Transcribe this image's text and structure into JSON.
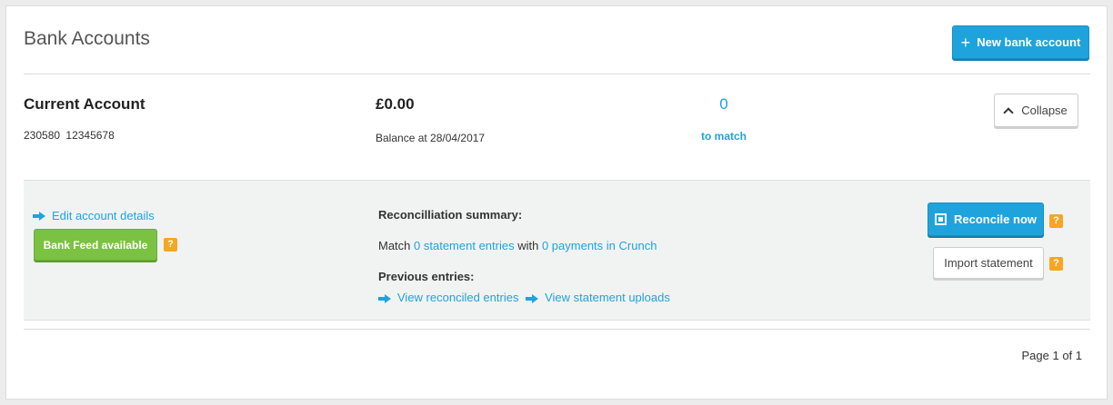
{
  "header": {
    "title": "Bank Accounts",
    "new_button_icon": "plus-icon",
    "new_button_label": "New bank account"
  },
  "account": {
    "name": "Current Account",
    "sort_code": "230580",
    "account_number": "12345678",
    "balance": "£0.00",
    "balance_label": "Balance at 28/04/2017",
    "to_match_count": "0",
    "to_match_label": "to match",
    "collapse_label": "Collapse"
  },
  "details": {
    "edit_link": "Edit account details",
    "bank_feed_label": "Bank Feed available",
    "help_glyph": "?",
    "reconciliation_title": "Reconcilliation summary:",
    "match_prefix": "Match",
    "statement_entries_link": "0 statement entries",
    "with_text": "with",
    "payments_link": "0 payments in Crunch",
    "previous_title": "Previous entries:",
    "view_reconciled_link": "View reconciled entries",
    "view_uploads_link": "View statement uploads",
    "reconcile_button": "Reconcile now",
    "import_button": "Import statement"
  },
  "pagination": {
    "text": "Page 1 of 1"
  },
  "colors": {
    "accent": "#1fa3dd",
    "success": "#7bc142",
    "help": "#f5a623"
  }
}
